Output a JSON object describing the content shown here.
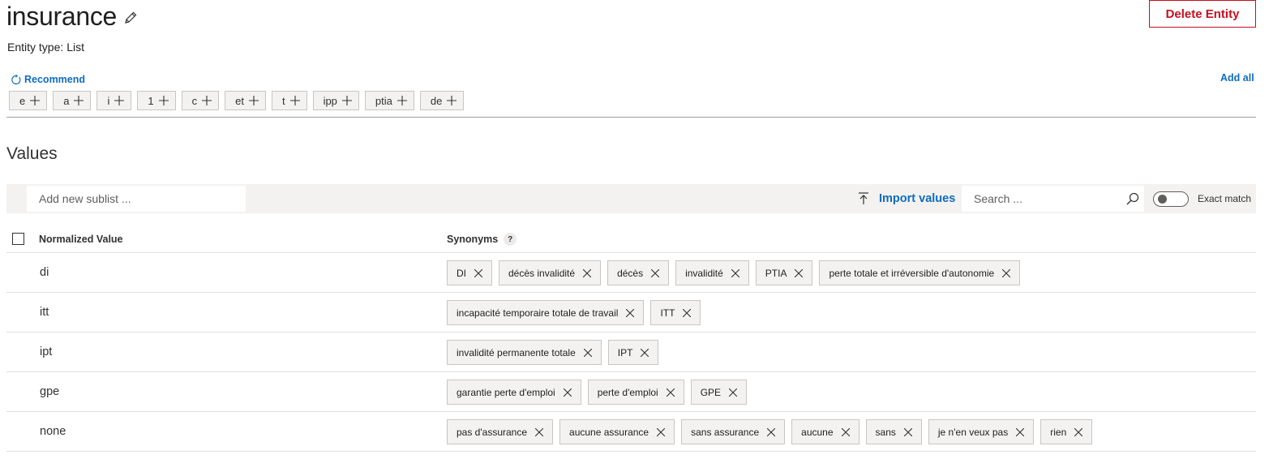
{
  "header": {
    "title": "insurance",
    "delete_label": "Delete Entity",
    "entity_type_label": "Entity type:",
    "entity_type_value": "List"
  },
  "recommend": {
    "label": "Recommend",
    "add_all_label": "Add all",
    "chips": [
      "e",
      "a",
      "i",
      "1",
      "c",
      "et",
      "t",
      "ipp",
      "ptia",
      "de"
    ]
  },
  "values": {
    "title": "Values",
    "sublist_placeholder": "Add new sublist ...",
    "import_label": "Import values",
    "search_placeholder": "Search ...",
    "exact_match_label": "Exact match",
    "exact_match_on": false
  },
  "table": {
    "col_normalized": "Normalized Value",
    "col_synonyms": "Synonyms",
    "help_glyph": "?",
    "rows": [
      {
        "value": "di",
        "synonyms": [
          "DI",
          "décès invalidité",
          "décès",
          "invalidité",
          "PTIA",
          "perte totale et irréversible d'autonomie"
        ]
      },
      {
        "value": "itt",
        "synonyms": [
          "incapacité temporaire totale de travail",
          "ITT"
        ]
      },
      {
        "value": "ipt",
        "synonyms": [
          "invalidité permanente totale",
          "IPT"
        ]
      },
      {
        "value": "gpe",
        "synonyms": [
          "garantie perte d'emploi",
          "perte d'emploi",
          "GPE"
        ]
      },
      {
        "value": "none",
        "synonyms": [
          "pas d'assurance",
          "aucune assurance",
          "sans assurance",
          "aucune",
          "sans",
          "je n'en veux pas",
          "rien"
        ]
      }
    ]
  },
  "colors": {
    "accent": "#0f6cbd",
    "danger": "#c50f1f",
    "chip_bg": "#f3f2f1",
    "toolbar_bg": "#f3f2f1"
  },
  "icons": {
    "edit": "pencil-icon",
    "recommend": "refresh-icon",
    "chip_add": "plus-icon",
    "import": "upload-icon",
    "search": "search-icon",
    "remove": "close-icon"
  }
}
